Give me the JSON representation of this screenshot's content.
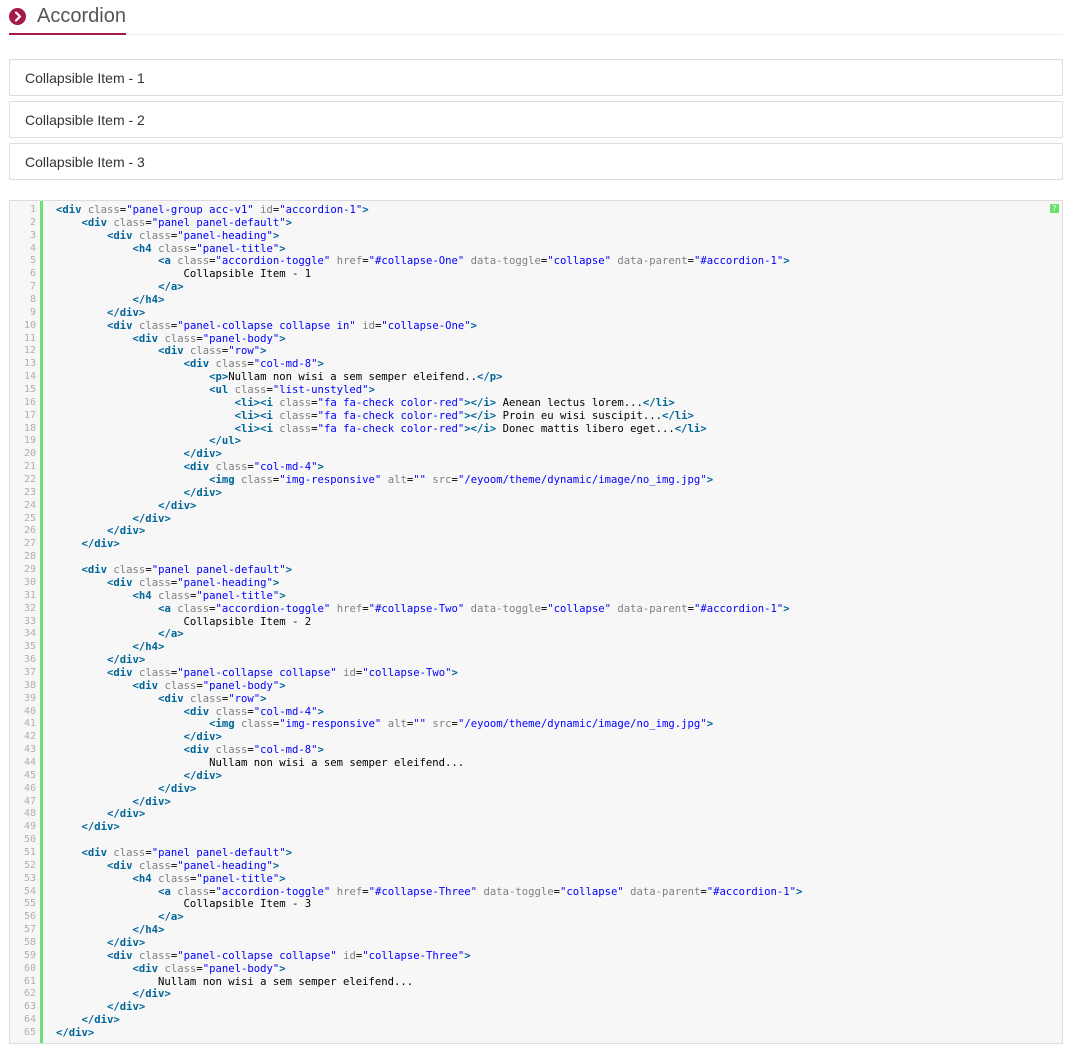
{
  "header": {
    "title": "Accordion",
    "icon": "chevron-right-circle-icon",
    "accent": "#a51a46"
  },
  "panels": [
    {
      "label": "Collapsible Item - 1"
    },
    {
      "label": "Collapsible Item - 2"
    },
    {
      "label": "Collapsible Item - 3"
    }
  ],
  "code": {
    "help": "?",
    "line_numbers": [
      "1",
      "2",
      "3",
      "4",
      "5",
      "6",
      "7",
      "8",
      "9",
      "10",
      "11",
      "12",
      "13",
      "14",
      "15",
      "16",
      "17",
      "18",
      "19",
      "20",
      "21",
      "22",
      "23",
      "24",
      "25",
      "26",
      "27",
      "28",
      "29",
      "30",
      "31",
      "32",
      "33",
      "34",
      "35",
      "36",
      "37",
      "38",
      "39",
      "40",
      "41",
      "42",
      "43",
      "44",
      "45",
      "46",
      "47",
      "48",
      "49",
      "50",
      "51",
      "52",
      "53",
      "54",
      "55",
      "56",
      "57",
      "58",
      "59",
      "60",
      "61",
      "62",
      "63",
      "64",
      "65"
    ],
    "lines": [
      "<div class=\"panel-group acc-v1\" id=\"accordion-1\">",
      "    <div class=\"panel panel-default\">",
      "        <div class=\"panel-heading\">",
      "            <h4 class=\"panel-title\">",
      "                <a class=\"accordion-toggle\" href=\"#collapse-One\" data-toggle=\"collapse\" data-parent=\"#accordion-1\">",
      "                    Collapsible Item - 1",
      "                </a>",
      "            </h4>",
      "        </div>",
      "        <div class=\"panel-collapse collapse in\" id=\"collapse-One\">",
      "            <div class=\"panel-body\">",
      "                <div class=\"row\">",
      "                    <div class=\"col-md-8\">",
      "                        <p>Nullam non wisi a sem semper eleifend..</p>",
      "                        <ul class=\"list-unstyled\">",
      "                            <li><i class=\"fa fa-check color-red\"></i> Aenean lectus lorem...</li>",
      "                            <li><i class=\"fa fa-check color-red\"></i> Proin eu wisi suscipit...</li>",
      "                            <li><i class=\"fa fa-check color-red\"></i> Donec mattis libero eget...</li>",
      "                        </ul>",
      "                    </div>",
      "                    <div class=\"col-md-4\">",
      "                        <img class=\"img-responsive\" alt=\"\" src=\"/eyoom/theme/dynamic/image/no_img.jpg\">",
      "                    </div>",
      "                </div>",
      "            </div>",
      "        </div>",
      "    </div>",
      "",
      "    <div class=\"panel panel-default\">",
      "        <div class=\"panel-heading\">",
      "            <h4 class=\"panel-title\">",
      "                <a class=\"accordion-toggle\" href=\"#collapse-Two\" data-toggle=\"collapse\" data-parent=\"#accordion-1\">",
      "                    Collapsible Item - 2",
      "                </a>",
      "            </h4>",
      "        </div>",
      "        <div class=\"panel-collapse collapse\" id=\"collapse-Two\">",
      "            <div class=\"panel-body\">",
      "                <div class=\"row\">",
      "                    <div class=\"col-md-4\">",
      "                        <img class=\"img-responsive\" alt=\"\" src=\"/eyoom/theme/dynamic/image/no_img.jpg\">",
      "                    </div>",
      "                    <div class=\"col-md-8\">",
      "                        Nullam non wisi a sem semper eleifend...",
      "                    </div>",
      "                </div>",
      "            </div>",
      "        </div>",
      "    </div>",
      "",
      "    <div class=\"panel panel-default\">",
      "        <div class=\"panel-heading\">",
      "            <h4 class=\"panel-title\">",
      "                <a class=\"accordion-toggle\" href=\"#collapse-Three\" data-toggle=\"collapse\" data-parent=\"#accordion-1\">",
      "                    Collapsible Item - 3",
      "                </a>",
      "            </h4>",
      "        </div>",
      "        <div class=\"panel-collapse collapse\" id=\"collapse-Three\">",
      "            <div class=\"panel-body\">",
      "                Nullam non wisi a sem semper eleifend...",
      "            </div>",
      "        </div>",
      "    </div>",
      "</div>"
    ]
  }
}
